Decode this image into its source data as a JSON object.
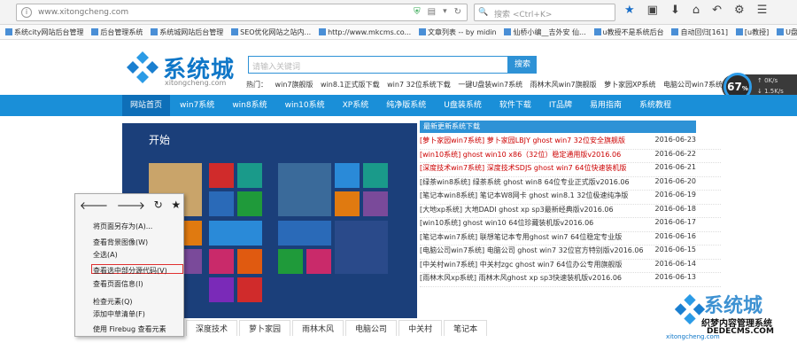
{
  "browser": {
    "url": "www.xitongcheng.com",
    "search_placeholder": "搜索 <Ctrl+K>"
  },
  "bookmarks": [
    "系统city网站后台管理",
    "后台管理系统",
    "系统城网站后台管理",
    "SEO优化网站之站内...",
    "http://www.mkcms.co...",
    "文章列表 -- by midin",
    "仙桥小编__吉外安 仙...",
    "u教授不是系统后台",
    "自动回归[161]",
    "[u教授]",
    "U盘装系"
  ],
  "site": {
    "logo_text": "系统城",
    "logo_sub": "xitongcheng.com",
    "search_placeholder": "请输入关键词",
    "search_button": "搜索",
    "hotlinks": [
      "热门：",
      "win7旗舰版",
      "win8.1正式版下载",
      "win7 32位系统下载",
      "一键U盘装win7系统",
      "雨林木风win7旗舰版",
      "萝卜家园XP系统",
      "电脑公司win7系统"
    ]
  },
  "gauge": {
    "value": "67",
    "unit": "%",
    "up": "↑ 0K/s",
    "down": "↓ 1.5K/s"
  },
  "nav": [
    "网站首页",
    "win7系统",
    "win8系统",
    "win10系统",
    "XP系统",
    "纯净版系统",
    "U盘装系统",
    "软件下载",
    "IT品牌",
    "易用指南",
    "系统教程"
  ],
  "start_label": "开始",
  "news_header": "最新更新系统下载",
  "news": [
    {
      "title": "[萝卜家园win7系统] 萝卜家园LBJY ghost win7 32位安全旗舰版",
      "date": "2016-06-23",
      "red": true
    },
    {
      "title": "[win10系统] ghost win10 x86（32位）稳定通用版v2016.06",
      "date": "2016-06-22",
      "red": true
    },
    {
      "title": "[深度技术win7系统] 深度技术SDJS ghost win7 64位快速装机版",
      "date": "2016-06-21",
      "red": true
    },
    {
      "title": "[绿茶win8系统] 绿茶系统 ghost win8 64位专业正式版v2016.06",
      "date": "2016-06-20",
      "red": false
    },
    {
      "title": "[笔记本win8系统] 笔记本W8网卡 ghost win8.1 32位极速纯净版",
      "date": "2016-06-19",
      "red": false
    },
    {
      "title": "[大地xp系统] 大地DADI ghost xp sp3最新经典版v2016.06",
      "date": "2016-06-18",
      "red": false
    },
    {
      "title": "[win10系统] ghost win10 64位珍藏装机版v2016.06",
      "date": "2016-06-17",
      "red": false
    },
    {
      "title": "[笔记本win7系统] 联想笔记本专用ghost win7 64位稳定专业版",
      "date": "2016-06-16",
      "red": false
    },
    {
      "title": "[电脑公司win7系统] 电脑公司 ghost win7 32位官方特别版v2016.06",
      "date": "2016-06-15",
      "red": false
    },
    {
      "title": "[中关村win7系统] 中关村zgc ghost win7 64位办公专用旗舰版",
      "date": "2016-06-14",
      "red": false
    },
    {
      "title": "[雨林木风xp系统] 雨林木风ghost xp sp3快速装机版v2016.06",
      "date": "2016-06-13",
      "red": false
    }
  ],
  "context_menu": [
    "将页面另存为(A)...",
    "查看背景图像(W)",
    "全选(A)",
    "查看选中部分源代码(V)",
    "查看页面信息(I)",
    "检查元素(Q)",
    "添加中草清单(F)",
    "使用 Firebug 查看元素"
  ],
  "bottom_tabs": [
    "深度技术",
    "萝卜家园",
    "雨林木风",
    "电脑公司",
    "中关村",
    "笔记本"
  ],
  "watermark": {
    "text": "系统城",
    "sub": "织梦内容管理系统",
    "sub2": "DEDECMS.COM",
    "logo_sub": "xitongcheng.com"
  },
  "colors": {
    "brand": "#1a8fd8",
    "nav_active": "#0e6fb8",
    "start_bg": "#1b3f7a",
    "news_red": "#cc0000"
  }
}
